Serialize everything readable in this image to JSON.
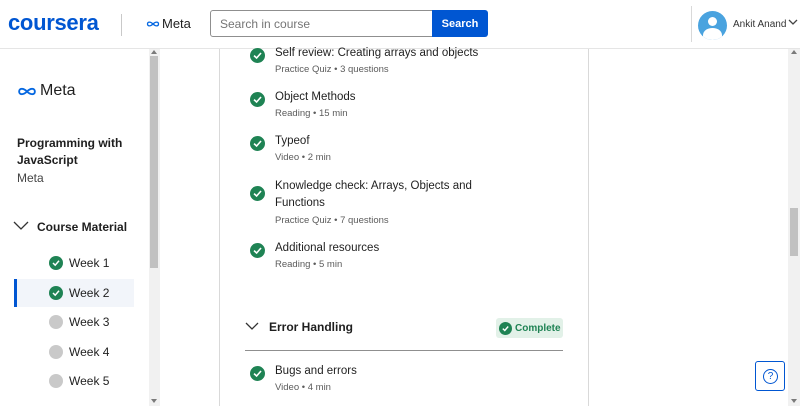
{
  "header": {
    "logo": "coursera",
    "partner": "Meta",
    "search_placeholder": "Search in course",
    "search_button": "Search",
    "user_name": "Ankit Anand"
  },
  "sidebar": {
    "partner_logo": "Meta",
    "course_title": "Programming with JavaScript",
    "course_org": "Meta",
    "section_label": "Course Material",
    "weeks": [
      {
        "label": "Week 1",
        "status": "complete"
      },
      {
        "label": "Week 2",
        "status": "complete",
        "active": true
      },
      {
        "label": "Week 3",
        "status": "incomplete"
      },
      {
        "label": "Week 4",
        "status": "incomplete"
      },
      {
        "label": "Week 5",
        "status": "incomplete"
      }
    ]
  },
  "main": {
    "items": [
      {
        "title": "Self review: Creating arrays and objects",
        "meta": "Practice Quiz • 3 questions",
        "status": "complete"
      },
      {
        "title": "Object Methods",
        "meta": "Reading • 15 min",
        "status": "complete"
      },
      {
        "title": "Typeof",
        "meta": "Video • 2 min",
        "status": "complete"
      },
      {
        "title": "Knowledge check: Arrays, Objects and Functions",
        "meta": "Practice Quiz • 7 questions",
        "status": "complete"
      },
      {
        "title": "Additional resources",
        "meta": "Reading • 5 min",
        "status": "complete"
      }
    ],
    "section": {
      "title": "Error Handling",
      "badge": "Complete",
      "items": [
        {
          "title": "Bugs and errors",
          "meta": "Video • 4 min",
          "status": "complete"
        }
      ]
    }
  },
  "help": {
    "icon_label": "?"
  },
  "colors": {
    "brand_blue": "#0056d2",
    "complete_green": "#1f8354",
    "badge_bg": "#e2f1e8"
  }
}
